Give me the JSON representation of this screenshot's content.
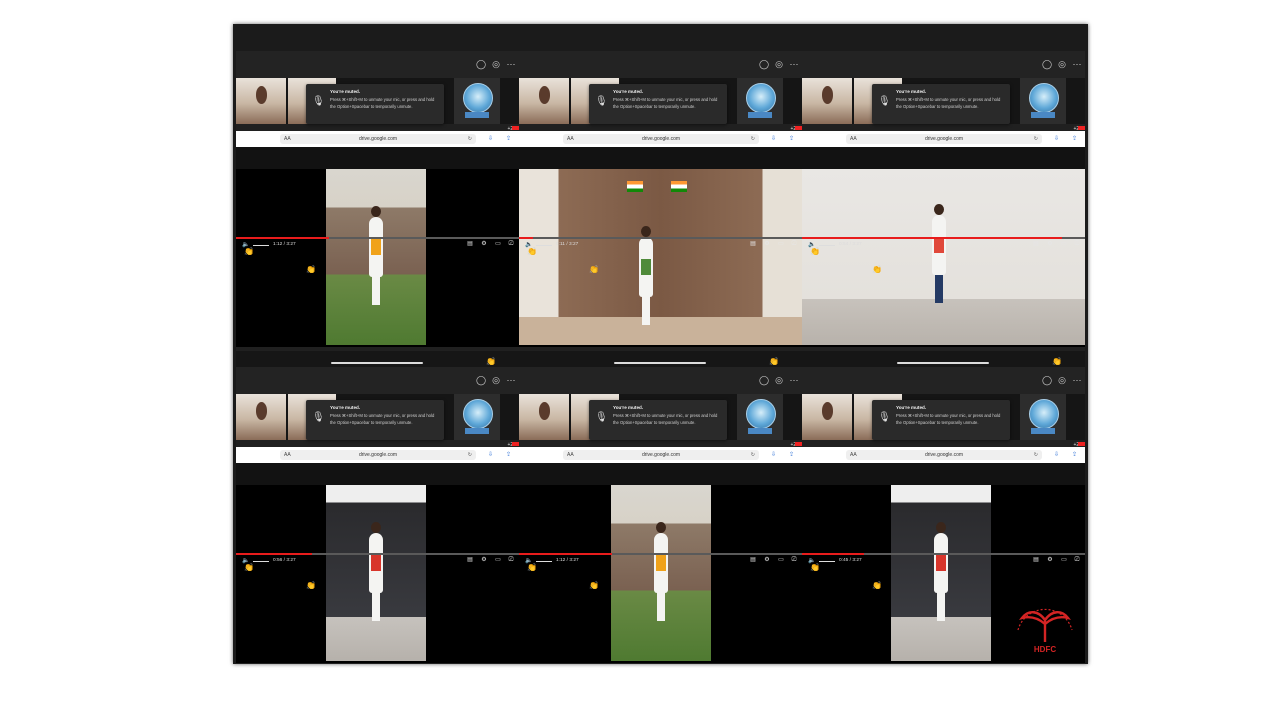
{
  "toast": {
    "title": "You're muted.",
    "body": "Press ⌘+Shift+M to unmute your mic, or press and hold the Option+Spacebar to temporarily unmute."
  },
  "browser": {
    "host": "drive.google.com",
    "text_size_label": "AA"
  },
  "meet": {
    "more_indicator": "•••",
    "extra_participants": "+22"
  },
  "panels": [
    {
      "time": "1:12 / 3:27",
      "progress": 0.33,
      "scene": "garden"
    },
    {
      "time": "0:11 / 3:27",
      "progress": 0.05,
      "scene": "door"
    },
    {
      "time": "0:54 / 3:27",
      "progress": 0.92,
      "scene": "studio"
    },
    {
      "time": "0:56 / 3:27",
      "progress": 0.27,
      "scene": "curtain"
    },
    {
      "time": "1:12 / 3:27",
      "progress": 0.33,
      "scene": "garden"
    },
    {
      "time": "0:45 / 3:27",
      "progress": 0.22,
      "scene": "curtain"
    }
  ],
  "watermark": {
    "text": "HDFC"
  },
  "icons": {
    "people": "people-icon",
    "activities": "activities-icon",
    "more": "more-icon",
    "mic_muted": "mic-muted-icon",
    "reload": "reload-icon",
    "download": "download-icon",
    "share": "share-icon",
    "volume": "volume-icon",
    "captions": "captions-icon",
    "settings": "settings-icon",
    "pip": "picture-in-picture-icon",
    "cast": "cast-icon",
    "reaction": "clapping-hands-icon"
  },
  "colors": {
    "progress": "#e81c1c",
    "toast_bg": "#2a2a2a",
    "link_blue": "#2b6fd6",
    "watermark": "#d42424"
  }
}
